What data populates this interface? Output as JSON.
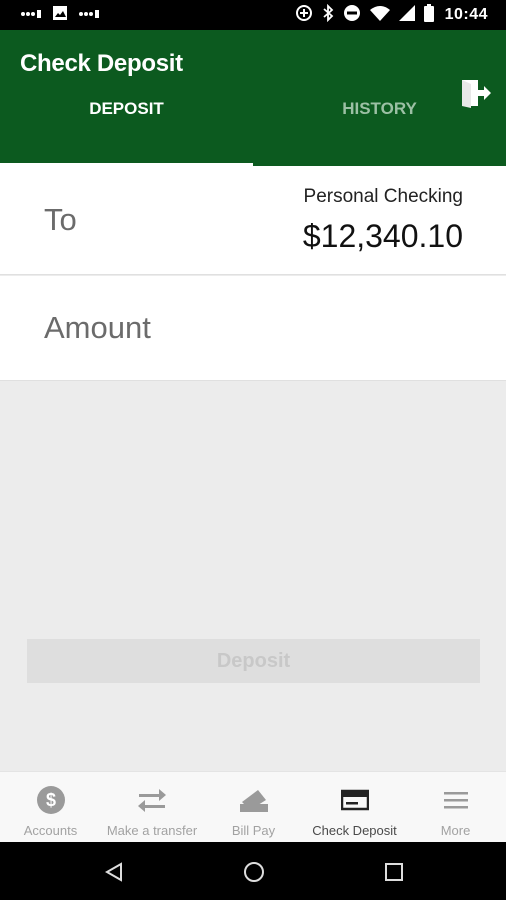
{
  "status_bar": {
    "time": "10:44",
    "icons": [
      "signal-dots-icon",
      "image-icon",
      "signal-dots-icon",
      "data-saver-icon",
      "bluetooth-icon",
      "do-not-disturb-icon",
      "wifi-icon",
      "cell-signal-icon",
      "battery-icon"
    ]
  },
  "header": {
    "title": "Check Deposit",
    "logout_icon": "logout-icon",
    "background_color": "#0c5a1f"
  },
  "tabs": [
    {
      "label": "DEPOSIT",
      "active": true
    },
    {
      "label": "HISTORY",
      "active": false
    }
  ],
  "form": {
    "to_label": "To",
    "account_name": "Personal Checking",
    "account_balance": "$12,340.10",
    "amount_label": "Amount"
  },
  "deposit_button": {
    "label": "Deposit",
    "enabled": false
  },
  "bottom_nav": [
    {
      "label": "Accounts",
      "icon": "dollar-circle-icon",
      "active": false
    },
    {
      "label": "Make a transfer",
      "icon": "transfer-arrows-icon",
      "active": false
    },
    {
      "label": "Bill Pay",
      "icon": "bill-pay-icon",
      "active": false
    },
    {
      "label": "Check Deposit",
      "icon": "check-icon",
      "active": true
    },
    {
      "label": "More",
      "icon": "menu-icon",
      "active": false
    }
  ],
  "system_nav": [
    "back-icon",
    "home-icon",
    "recents-icon"
  ]
}
